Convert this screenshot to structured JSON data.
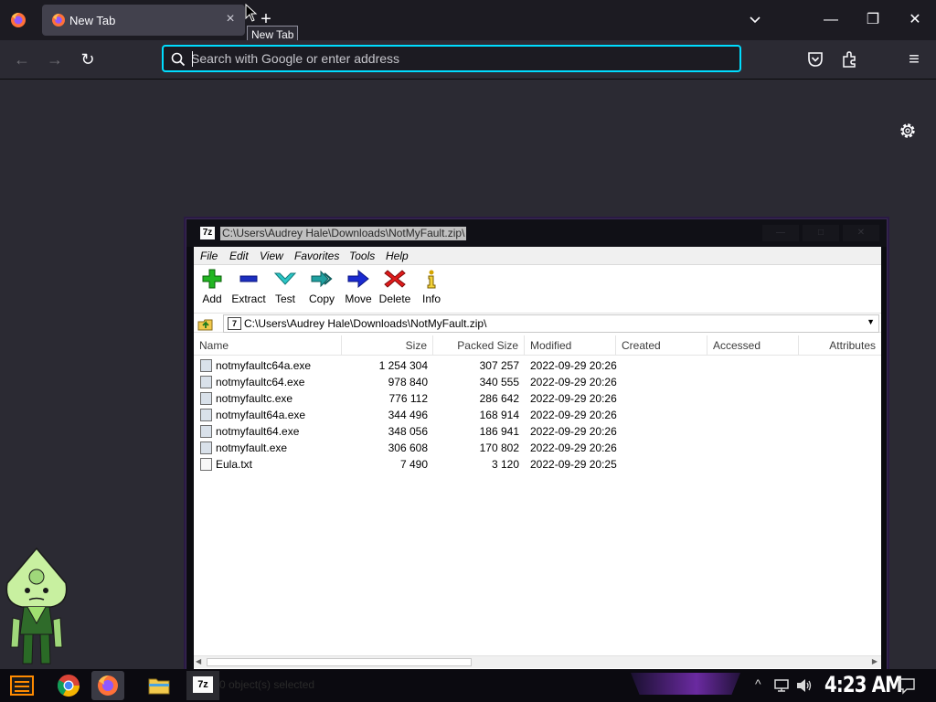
{
  "browser": {
    "tab": {
      "title": "New Tab"
    },
    "new_tab_tooltip": "New Tab",
    "new_tab_symbol": "+",
    "urlbar": {
      "placeholder": "Search with Google or enter address",
      "value": ""
    },
    "window_controls": {
      "minimize": "—",
      "maximize": "❐",
      "close": "✕"
    },
    "nav": {
      "back": "←",
      "forward": "→",
      "reload": "↻",
      "menu": "≡"
    },
    "accent": "#00ddff"
  },
  "sevenzip": {
    "app_icon": "7z",
    "title": "C:\\Users\\Audrey Hale\\Downloads\\NotMyFault.zip\\",
    "menu": [
      "File",
      "Edit",
      "View",
      "Favorites",
      "Tools",
      "Help"
    ],
    "toolbar": [
      {
        "label": "Add",
        "icon": "plus-icon"
      },
      {
        "label": "Extract",
        "icon": "minus-icon"
      },
      {
        "label": "Test",
        "icon": "check-icon"
      },
      {
        "label": "Copy",
        "icon": "double-arrow-icon"
      },
      {
        "label": "Move",
        "icon": "arrow-right-icon"
      },
      {
        "label": "Delete",
        "icon": "x-icon"
      },
      {
        "label": "Info",
        "icon": "info-icon"
      }
    ],
    "address": "C:\\Users\\Audrey Hale\\Downloads\\NotMyFault.zip\\",
    "columns": [
      "Name",
      "Size",
      "Packed Size",
      "Modified",
      "Created",
      "Accessed",
      "Attributes"
    ],
    "files": [
      {
        "name": "notmyfaultc64a.exe",
        "size": "1 254 304",
        "packed": "307 257",
        "modified": "2022-09-29 20:26",
        "type": "exe"
      },
      {
        "name": "notmyfaultc64.exe",
        "size": "978 840",
        "packed": "340 555",
        "modified": "2022-09-29 20:26",
        "type": "exe"
      },
      {
        "name": "notmyfaultc.exe",
        "size": "776 112",
        "packed": "286 642",
        "modified": "2022-09-29 20:26",
        "type": "exe"
      },
      {
        "name": "notmyfault64a.exe",
        "size": "344 496",
        "packed": "168 914",
        "modified": "2022-09-29 20:26",
        "type": "exe"
      },
      {
        "name": "notmyfault64.exe",
        "size": "348 056",
        "packed": "186 941",
        "modified": "2022-09-29 20:26",
        "type": "exe"
      },
      {
        "name": "notmyfault.exe",
        "size": "306 608",
        "packed": "170 802",
        "modified": "2022-09-29 20:26",
        "type": "exe"
      },
      {
        "name": "Eula.txt",
        "size": "7 490",
        "packed": "3 120",
        "modified": "2022-09-29 20:25",
        "type": "txt"
      }
    ],
    "status": "0 object(s) selected",
    "dropdown_symbol": "▼",
    "up_symbol": "⇧"
  },
  "taskbar": {
    "clock": "4:23 AM",
    "seven_zip_label": "7z"
  }
}
